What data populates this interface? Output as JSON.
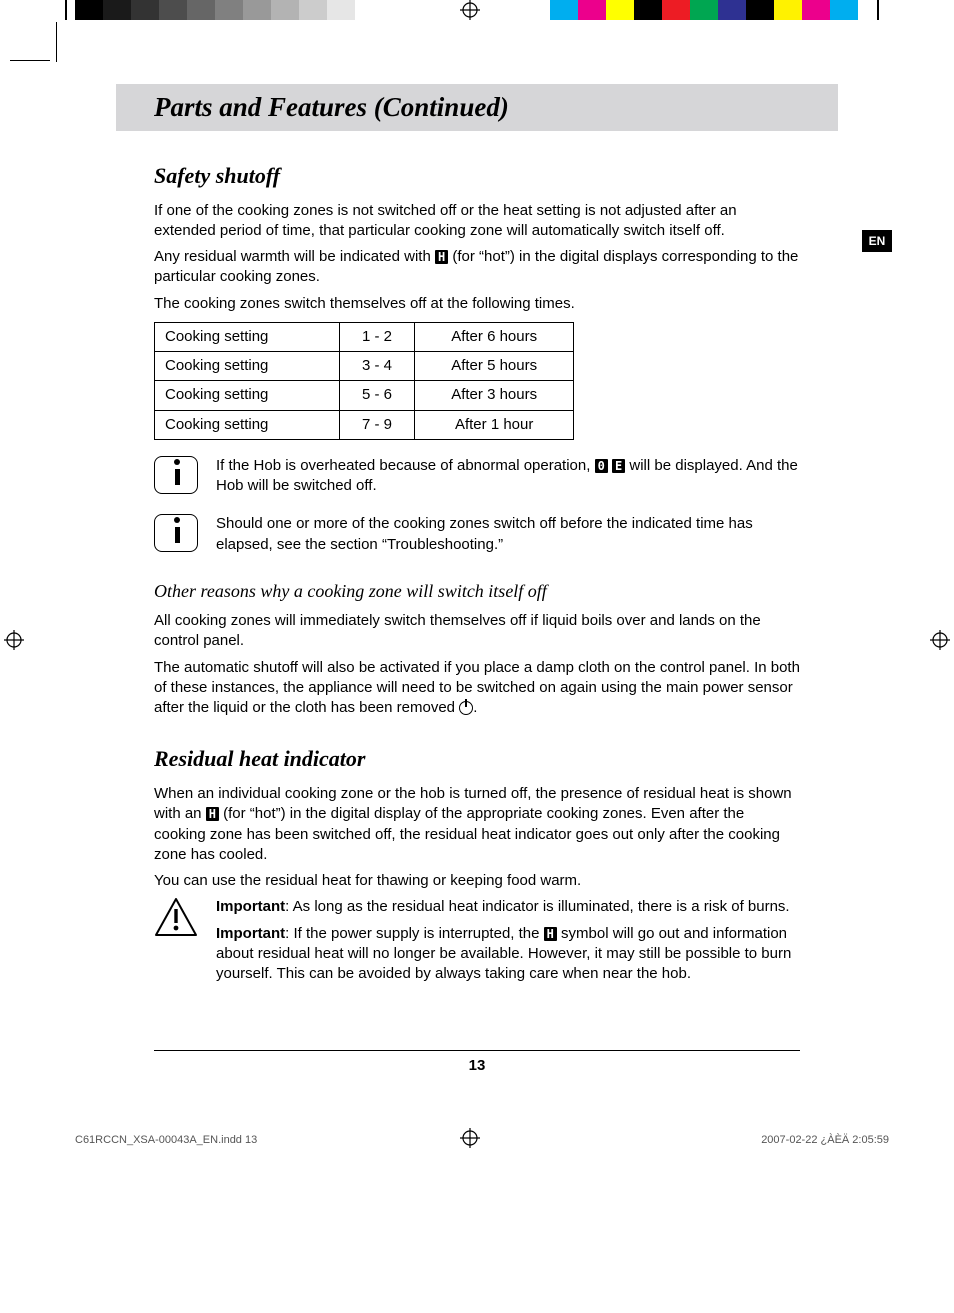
{
  "lang_tab": "EN",
  "header": {
    "title": "Parts and Features (Continued)"
  },
  "safety": {
    "heading": "Safety shutoff",
    "p1": "If one of the cooking zones is not switched off or the heat setting is not adjusted after an extended period of time, that particular cooking zone will automatically switch itself off.",
    "p2a": "Any residual warmth will be indicated with ",
    "p2b": " (for “hot”) in the digital displays corresponding to the particular cooking zones.",
    "p3": "The cooking zones switch themselves off at the following times.",
    "table": [
      {
        "label": "Cooking setting",
        "range": "1 - 2",
        "time": "After 6 hours"
      },
      {
        "label": "Cooking setting",
        "range": "3 - 4",
        "time": "After 5 hours"
      },
      {
        "label": "Cooking setting",
        "range": "5 - 6",
        "time": "After 3 hours"
      },
      {
        "label": "Cooking setting",
        "range": "7 - 9",
        "time": "After 1 hour"
      }
    ],
    "note1a": "If the Hob is overheated because of abnormal operation, ",
    "note1b": " will be displayed. And the Hob will be switched off.",
    "note2": "Should one or more of the cooking zones switch off before the indicated time has elapsed, see the section “Troubleshooting.”"
  },
  "other": {
    "heading": "Other reasons why a cooking zone will switch itself off",
    "p1": "All cooking zones will immediately switch themselves off if liquid boils over and lands on the control panel.",
    "p2a": "The automatic shutoff will also be activated if you place a damp cloth on the control panel. In both of these instances, the appliance will need to be switched on again using the main power sensor after the liquid or the cloth has been removed ",
    "p2b": "."
  },
  "residual": {
    "heading": "Residual heat indicator",
    "p1a": "When an individual cooking zone or the hob is turned off, the presence of residual heat is shown with an ",
    "p1b": " (for “hot”) in the digital display of the appropriate cooking zones. Even after the cooking zone has been switched off, the residual heat indicator goes out only after the cooking zone has cooled.",
    "p2": "You can use the residual heat for thawing or keeping food warm.",
    "warn1_label": "Important",
    "warn1": ": As long as the residual heat indicator is illuminated, there is a risk of burns.",
    "warn2_label": "Important",
    "warn2a": ": If the power supply is interrupted, the ",
    "warn2b": " symbol will go out and information about residual heat will no longer be available. However, it may still be possible to burn yourself. This can be avoided by always taking care when near the hob."
  },
  "glyphs": {
    "H": "H",
    "overheat1": "0",
    "overheat2": "E"
  },
  "page_number": "13",
  "footer": {
    "filename": "C61RCCN_XSA-00043A_EN.indd   13",
    "datetime": "2007-02-22   ¿ÀÈÄ 2:05:59"
  },
  "prepress": {
    "grays": [
      "#000000",
      "#1a1a1a",
      "#333333",
      "#4d4d4d",
      "#666666",
      "#808080",
      "#999999",
      "#b3b3b3",
      "#cccccc",
      "#e6e6e6",
      "#ffffff"
    ],
    "colors": [
      "#00aeef",
      "#ec008c",
      "#ffff00",
      "#000000",
      "#ed1c24",
      "#00a651",
      "#2e3192",
      "#000000",
      "#fff200",
      "#ec008c",
      "#00aeef",
      "#ffffff"
    ]
  }
}
